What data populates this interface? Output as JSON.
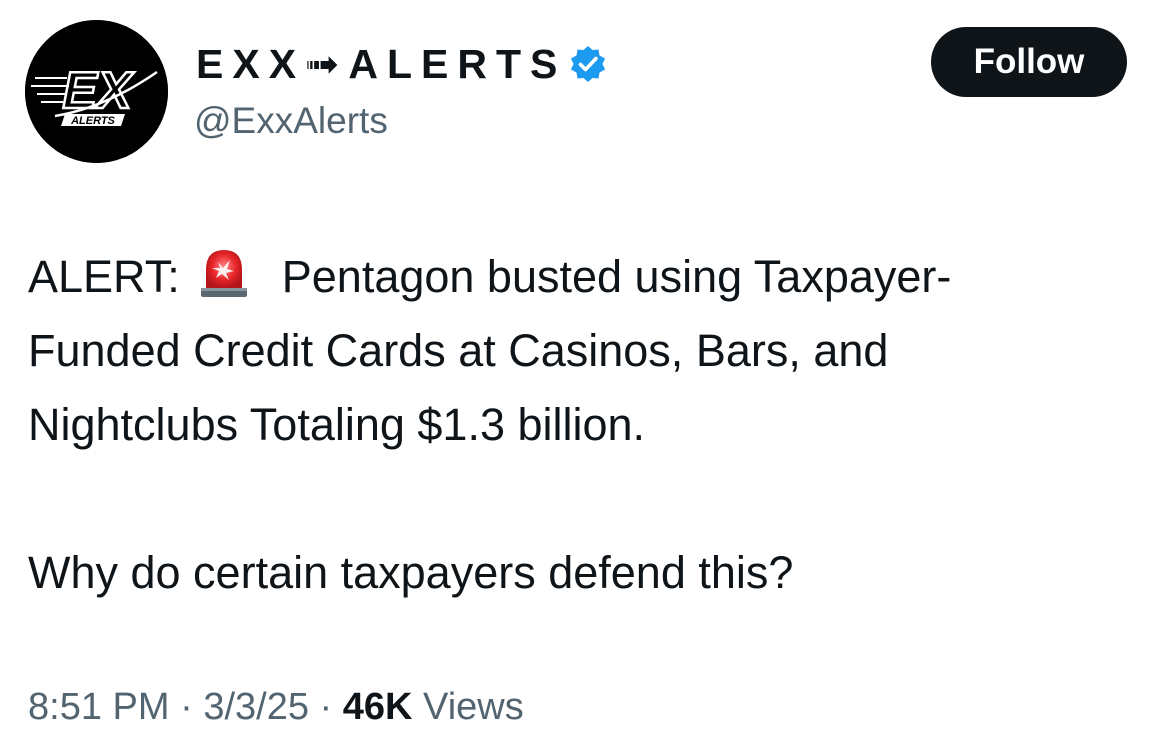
{
  "account": {
    "display_name": "EXX➟ALERTS",
    "handle": "@ExxAlerts",
    "avatar_text": "EX",
    "avatar_subtext": "ALERTS",
    "verified": true,
    "verified_color": "#1d9bf0"
  },
  "follow_button": {
    "label": "Follow"
  },
  "tweet": {
    "prefix": "ALERT:",
    "emoji_icon": "police-siren-icon",
    "line1_rest": "Pentagon busted using Taxpayer-",
    "line2": "Funded Credit Cards at Casinos, Bars, and",
    "line3": "Nightclubs Totaling $1.3 billion.",
    "line4": "Why do certain taxpayers defend this?"
  },
  "meta": {
    "time": "8:51 PM",
    "separator": " · ",
    "date": "3/3/25",
    "views_count": "46K",
    "views_label": "Views"
  }
}
